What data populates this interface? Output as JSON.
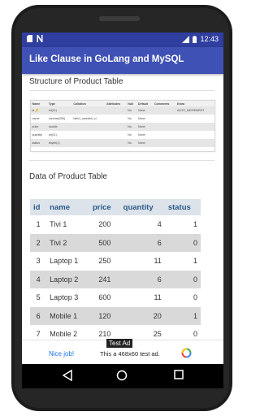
{
  "status_bar": {
    "time": "12:43",
    "left_icons": [
      "sd-card-icon",
      "n-notification-icon"
    ],
    "right_icons": [
      "signal-icon",
      "battery-icon"
    ]
  },
  "app_bar": {
    "title": "Like Clause in GoLang and MySQL"
  },
  "structure_section": {
    "heading": "Structure of Product Table",
    "columns": [
      "Name",
      "Type",
      "Collation",
      "Attributes",
      "Null",
      "Default",
      "Comments",
      "Extra"
    ],
    "rows": [
      [
        "id 🔑",
        "int(11)",
        "",
        "",
        "No",
        "None",
        "",
        "AUTO_INCREMENT"
      ],
      [
        "name",
        "varchar(250)",
        "latin1_swedish_ci",
        "",
        "No",
        "None",
        "",
        ""
      ],
      [
        "price",
        "double",
        "",
        "",
        "No",
        "None",
        "",
        ""
      ],
      [
        "quantity",
        "int(11)",
        "",
        "",
        "No",
        "None",
        "",
        ""
      ],
      [
        "status",
        "tinyint(1)",
        "",
        "",
        "No",
        "None",
        "",
        ""
      ]
    ]
  },
  "data_section": {
    "heading": "Data of Product Table",
    "columns": [
      "id",
      "name",
      "price",
      "quantity",
      "status"
    ],
    "rows": [
      [
        "1",
        "Tivi 1",
        "200",
        "4",
        "1"
      ],
      [
        "2",
        "Tivi 2",
        "500",
        "6",
        "0"
      ],
      [
        "3",
        "Laptop 1",
        "250",
        "11",
        "1"
      ],
      [
        "4",
        "Laptop 2",
        "241",
        "6",
        "0"
      ],
      [
        "5",
        "Laptop 3",
        "600",
        "11",
        "0"
      ],
      [
        "6",
        "Mobile 1",
        "120",
        "20",
        "1"
      ],
      [
        "7",
        "Mobile 2",
        "210",
        "25",
        "0"
      ]
    ]
  },
  "ad_banner": {
    "label": "Test Ad",
    "nice_text": "Nice job!",
    "body_text": "This a 468x60 test ad."
  },
  "colors": {
    "status_bar": "#303f9f",
    "app_bar": "#3f51b5",
    "table_header_bg": "#dce3ea",
    "table_header_text": "#2c5a8a",
    "row_stripe": "#d9d9d9"
  },
  "nav_bar": {
    "buttons": [
      "back-icon",
      "home-icon",
      "recents-icon"
    ]
  }
}
